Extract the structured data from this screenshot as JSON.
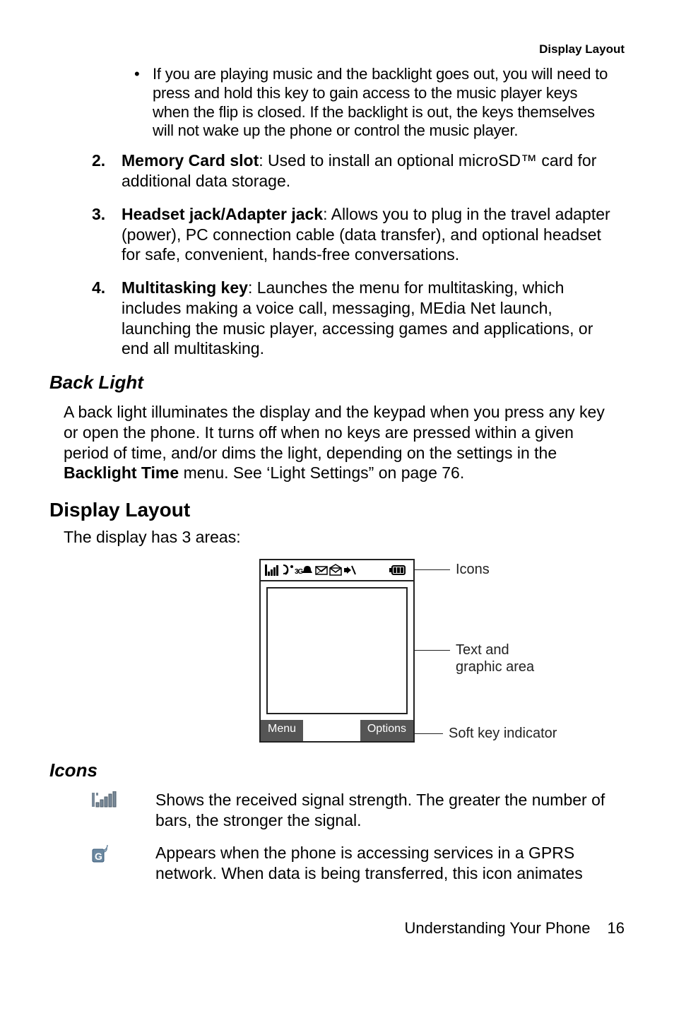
{
  "running_head": "Display Layout",
  "bullet1": "If you are playing music and the backlight goes out, you will need to press and hold this key to gain access to the music player keys when the flip is closed. If the backlight is out, the keys themselves will not wake up the phone or control the music player.",
  "list": {
    "n2": {
      "num": "2.",
      "lead": "Memory Card slot",
      "text": ": Used to install an optional microSD™ card for additional data storage."
    },
    "n3": {
      "num": "3.",
      "lead": "Headset jack/Adapter jack",
      "text": ": Allows you to plug in the travel adapter (power), PC connection cable (data transfer), and optional headset for safe, convenient, hands-free conversations."
    },
    "n4": {
      "num": "4.",
      "lead": "Multitasking key",
      "text": ": Launches the menu for multitasking, which includes making a voice call, messaging, MEdia Net launch, launching the music player, accessing games and applications, or end all multitasking."
    }
  },
  "h_backlight": "Back Light",
  "para_backlight_a": "A back light illuminates the display and the keypad when you press any key or open the phone. It turns off when no keys are pressed within a given period of time, and/or dims the light, depending on the settings in the ",
  "para_backlight_bold": "Backlight Time",
  "para_backlight_b": " menu.  See ‘Light Settings” on page 76.",
  "h_display": "Display Layout",
  "para_display": "The display has 3 areas:",
  "diagram": {
    "soft_left": "Menu",
    "soft_right": "Options",
    "lbl_icons": "Icons",
    "lbl_text": "Text and",
    "lbl_graphic": "graphic area",
    "lbl_soft": "Soft key indicator"
  },
  "h_icons": "Icons",
  "iconrows": {
    "signal": "Shows the received signal strength. The greater the number of bars, the stronger the signal.",
    "gprs": "Appears when the phone is accessing services in a GPRS network. When data is being transferred, this icon animates"
  },
  "footer_text": "Understanding Your Phone",
  "footer_page": "16"
}
